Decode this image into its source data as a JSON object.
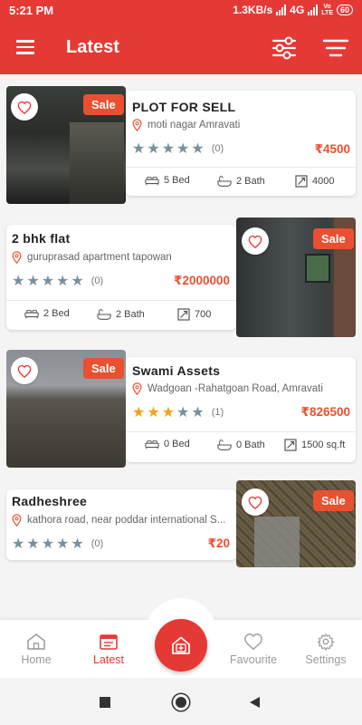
{
  "status_bar": {
    "time": "5:21 PM",
    "net_speed": "1.3KB/s",
    "network": "4G",
    "volte": "Vo",
    "lte": "LTE",
    "battery": "60"
  },
  "app_bar": {
    "title": "Latest",
    "menu_icon": "hamburger-menu-icon",
    "filter_icon": "filter-sliders-icon",
    "sort_icon": "sort-lines-icon"
  },
  "colors": {
    "primary": "#e53935",
    "price": "#e9502f",
    "star_filled": "#f4a21c",
    "star_empty": "#78909c"
  },
  "listings": [
    {
      "title": "PLOT FOR SELL",
      "location": "moti nagar Amravati",
      "badge": "Sale",
      "rating": 0,
      "rating_count": "(0)",
      "price": "₹4500",
      "bed": "5 Bed",
      "bath": "2 Bath",
      "area": "4000"
    },
    {
      "title": "2 bhk flat",
      "location": "guruprasad  apartment tapowan",
      "badge": "Sale",
      "rating": 0,
      "rating_count": "(0)",
      "price": "₹2000000",
      "bed": "2 Bed",
      "bath": "2 Bath",
      "area": "700"
    },
    {
      "title": "Swami Assets",
      "location": "Wadgoan -Rahatgoan Road, Amravati",
      "badge": "Sale",
      "rating": 3,
      "rating_count": "(1)",
      "price": "₹826500",
      "bed": "0 Bed",
      "bath": "0 Bath",
      "area": "1500 sq.ft"
    },
    {
      "title": "Radheshree",
      "location": "kathora road, near poddar international S...",
      "badge": "Sale",
      "rating": 0,
      "rating_count": "(0)",
      "price": "₹20"
    }
  ],
  "bottom_nav": {
    "home": "Home",
    "latest": "Latest",
    "favourite": "Favourite",
    "settings": "Settings",
    "active": "latest",
    "fab_icon": "add-home-icon"
  },
  "system_nav": {
    "recents_icon": "recents-square-icon",
    "home_icon": "home-circle-icon",
    "back_icon": "back-triangle-icon"
  }
}
